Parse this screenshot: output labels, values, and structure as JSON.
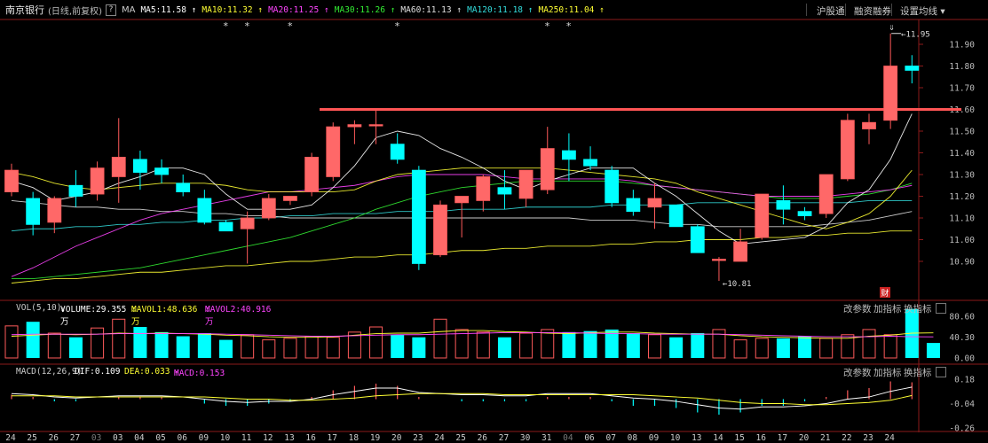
{
  "header": {
    "title": "南京银行",
    "subtitle": "(日线,前复权)",
    "help": "?",
    "ma_label": "MA",
    "ma_items": [
      {
        "text": "MA5:11.58",
        "color": "#ffffff"
      },
      {
        "text": "MA10:11.32",
        "color": "#ffff33"
      },
      {
        "text": "MA20:11.25",
        "color": "#ff44ff"
      },
      {
        "text": "MA30:11.26",
        "color": "#33ee33"
      },
      {
        "text": "MA60:11.13",
        "color": "#e0e0e0"
      },
      {
        "text": "MA120:11.18",
        "color": "#33dddd"
      },
      {
        "text": "MA250:11.04",
        "color": "#ffff33"
      }
    ],
    "arrow_up": "↑",
    "links": {
      "hgt": "沪股通",
      "rzrq": "融资融券",
      "settings": "设置均线"
    }
  },
  "price_axis": [
    "11.90",
    "11.80",
    "11.70",
    "11.60",
    "11.50",
    "11.40",
    "11.30",
    "11.20",
    "11.10",
    "11.00",
    "10.90"
  ],
  "annotations": {
    "high": "11.95",
    "low": "10.81",
    "fin_badge": "财",
    "star": "*"
  },
  "volume_panel": {
    "label": "VOL(5,10)",
    "volume": "VOLUME:29.355万",
    "mavol1": "MAVOL1:48.636万",
    "mavol2": "MAVOL2:40.916万",
    "arrow_down": "↓",
    "buttons": {
      "params": "改参数",
      "add": "加指标",
      "swap": "换指标"
    },
    "axis": [
      "80.60",
      "40.30",
      "0.00"
    ]
  },
  "macd_panel": {
    "label": "MACD(12,26,9)",
    "dif": "DIF:0.109",
    "dea": "DEA:0.033",
    "macd": "MACD:0.153",
    "arrow_up": "↑",
    "buttons": {
      "params": "改参数",
      "add": "加指标",
      "swap": "换指标"
    },
    "axis": [
      "0.18",
      "-0.04",
      "-0.26"
    ]
  },
  "date_axis": [
    "24",
    "25",
    "26",
    "27",
    "03",
    "03",
    "04",
    "05",
    "06",
    "09",
    "10",
    "11",
    "12",
    "13",
    "16",
    "17",
    "18",
    "19",
    "20",
    "23",
    "24",
    "25",
    "26",
    "27",
    "30",
    "31",
    "04",
    "06",
    "07",
    "08",
    "09",
    "10",
    "13",
    "14",
    "15",
    "16",
    "17",
    "20",
    "21",
    "22",
    "23",
    "24"
  ],
  "chart_data": {
    "type": "candlestick",
    "price_range": [
      10.8,
      11.97
    ],
    "resistance_line": 11.6,
    "candles": [
      {
        "o": 11.22,
        "h": 11.35,
        "l": 11.2,
        "c": 11.32
      },
      {
        "o": 11.19,
        "h": 11.22,
        "l": 11.02,
        "c": 11.07
      },
      {
        "o": 11.08,
        "h": 11.2,
        "l": 11.03,
        "c": 11.19
      },
      {
        "o": 11.25,
        "h": 11.32,
        "l": 11.15,
        "c": 11.2
      },
      {
        "o": 11.21,
        "h": 11.36,
        "l": 11.18,
        "c": 11.33
      },
      {
        "o": 11.29,
        "h": 11.56,
        "l": 11.17,
        "c": 11.38
      },
      {
        "o": 11.37,
        "h": 11.41,
        "l": 11.23,
        "c": 11.31
      },
      {
        "o": 11.33,
        "h": 11.37,
        "l": 11.26,
        "c": 11.3
      },
      {
        "o": 11.26,
        "h": 11.3,
        "l": 11.2,
        "c": 11.22
      },
      {
        "o": 11.19,
        "h": 11.23,
        "l": 11.07,
        "c": 11.08
      },
      {
        "o": 11.08,
        "h": 11.09,
        "l": 11.04,
        "c": 11.04
      },
      {
        "o": 11.05,
        "h": 11.13,
        "l": 10.89,
        "c": 11.1
      },
      {
        "o": 11.1,
        "h": 11.21,
        "l": 11.09,
        "c": 11.19
      },
      {
        "o": 11.18,
        "h": 11.2,
        "l": 11.16,
        "c": 11.2
      },
      {
        "o": 11.22,
        "h": 11.4,
        "l": 11.2,
        "c": 11.38
      },
      {
        "o": 11.29,
        "h": 11.54,
        "l": 11.27,
        "c": 11.52
      },
      {
        "o": 11.52,
        "h": 11.55,
        "l": 11.44,
        "c": 11.53
      },
      {
        "o": 11.53,
        "h": 11.6,
        "l": 11.44,
        "c": 11.53
      },
      {
        "o": 11.44,
        "h": 11.49,
        "l": 11.35,
        "c": 11.37
      },
      {
        "o": 11.32,
        "h": 11.34,
        "l": 10.86,
        "c": 10.89
      },
      {
        "o": 10.93,
        "h": 11.18,
        "l": 10.92,
        "c": 11.16
      },
      {
        "o": 11.17,
        "h": 11.2,
        "l": 11.01,
        "c": 11.2
      },
      {
        "o": 11.18,
        "h": 11.3,
        "l": 11.13,
        "c": 11.29
      },
      {
        "o": 11.24,
        "h": 11.32,
        "l": 11.14,
        "c": 11.21
      },
      {
        "o": 11.19,
        "h": 11.32,
        "l": 11.15,
        "c": 11.32
      },
      {
        "o": 11.23,
        "h": 11.52,
        "l": 11.21,
        "c": 11.42
      },
      {
        "o": 11.41,
        "h": 11.49,
        "l": 11.27,
        "c": 11.37
      },
      {
        "o": 11.37,
        "h": 11.43,
        "l": 11.32,
        "c": 11.34
      },
      {
        "o": 11.32,
        "h": 11.34,
        "l": 11.15,
        "c": 11.17
      },
      {
        "o": 11.19,
        "h": 11.23,
        "l": 11.11,
        "c": 11.13
      },
      {
        "o": 11.15,
        "h": 11.26,
        "l": 11.05,
        "c": 11.19
      },
      {
        "o": 11.16,
        "h": 11.16,
        "l": 11.07,
        "c": 11.06
      },
      {
        "o": 11.06,
        "h": 11.07,
        "l": 10.95,
        "c": 10.94
      },
      {
        "o": 10.91,
        "h": 10.92,
        "l": 10.81,
        "c": 10.91
      },
      {
        "o": 10.9,
        "h": 11.05,
        "l": 10.9,
        "c": 10.99
      },
      {
        "o": 11.01,
        "h": 11.2,
        "l": 11.0,
        "c": 11.21
      },
      {
        "o": 11.18,
        "h": 11.25,
        "l": 11.07,
        "c": 11.14
      },
      {
        "o": 11.13,
        "h": 11.15,
        "l": 11.09,
        "c": 11.11
      },
      {
        "o": 11.12,
        "h": 11.3,
        "l": 11.1,
        "c": 11.3
      },
      {
        "o": 11.28,
        "h": 11.58,
        "l": 11.27,
        "c": 11.55
      },
      {
        "o": 11.51,
        "h": 11.58,
        "l": 11.44,
        "c": 11.54
      },
      {
        "o": 11.55,
        "h": 11.95,
        "l": 11.51,
        "c": 11.8
      },
      {
        "o": 11.8,
        "h": 11.85,
        "l": 11.72,
        "c": 11.78
      }
    ],
    "ma_lines": {
      "ma5": {
        "color": "#ffffff",
        "values": [
          11.27,
          11.24,
          11.18,
          11.2,
          11.22,
          11.26,
          11.29,
          11.33,
          11.33,
          11.3,
          11.21,
          11.14,
          11.14,
          11.14,
          11.16,
          11.24,
          11.34,
          11.47,
          11.5,
          11.48,
          11.42,
          11.38,
          11.33,
          11.27,
          11.23,
          11.27,
          11.3,
          11.33,
          11.33,
          11.33,
          11.26,
          11.2,
          11.12,
          11.04,
          10.98,
          10.99,
          11.0,
          11.01,
          11.06,
          11.17,
          11.23,
          11.37,
          11.58
        ]
      },
      "ma10": {
        "color": "#ffff33",
        "values": [
          11.31,
          11.29,
          11.26,
          11.24,
          11.23,
          11.24,
          11.25,
          11.26,
          11.26,
          11.26,
          11.25,
          11.23,
          11.22,
          11.22,
          11.22,
          11.22,
          11.23,
          11.27,
          11.3,
          11.31,
          11.32,
          11.33,
          11.33,
          11.33,
          11.33,
          11.33,
          11.32,
          11.31,
          11.3,
          11.29,
          11.28,
          11.26,
          11.22,
          11.19,
          11.16,
          11.13,
          11.1,
          11.07,
          11.05,
          11.08,
          11.12,
          11.2,
          11.32
        ]
      },
      "ma20": {
        "color": "#ff44ff",
        "values": [
          10.83,
          10.87,
          10.92,
          10.97,
          11.01,
          11.05,
          11.09,
          11.12,
          11.14,
          11.16,
          11.18,
          11.2,
          11.22,
          11.22,
          11.23,
          11.24,
          11.25,
          11.27,
          11.29,
          11.3,
          11.3,
          11.3,
          11.3,
          11.29,
          11.28,
          11.28,
          11.28,
          11.28,
          11.28,
          11.27,
          11.25,
          11.24,
          11.23,
          11.22,
          11.21,
          11.2,
          11.2,
          11.2,
          11.2,
          11.21,
          11.22,
          11.23,
          11.25
        ]
      },
      "ma30": {
        "color": "#33ee33",
        "values": [
          10.82,
          10.82,
          10.83,
          10.84,
          10.85,
          10.86,
          10.87,
          10.89,
          10.91,
          10.93,
          10.95,
          10.97,
          10.99,
          11.01,
          11.04,
          11.07,
          11.1,
          11.14,
          11.17,
          11.2,
          11.22,
          11.24,
          11.25,
          11.26,
          11.27,
          11.27,
          11.27,
          11.27,
          11.27,
          11.26,
          11.25,
          11.24,
          11.23,
          11.22,
          11.21,
          11.2,
          11.19,
          11.19,
          11.19,
          11.2,
          11.21,
          11.23,
          11.26
        ]
      },
      "ma60": {
        "color": "#e0e0e0",
        "values": [
          11.18,
          11.17,
          11.16,
          11.15,
          11.15,
          11.14,
          11.14,
          11.13,
          11.13,
          11.12,
          11.12,
          11.11,
          11.11,
          11.1,
          11.1,
          11.1,
          11.1,
          11.1,
          11.1,
          11.1,
          11.1,
          11.1,
          11.1,
          11.1,
          11.1,
          11.1,
          11.1,
          11.09,
          11.09,
          11.09,
          11.08,
          11.07,
          11.07,
          11.06,
          11.06,
          11.06,
          11.06,
          11.06,
          11.07,
          11.08,
          11.09,
          11.11,
          11.13
        ]
      },
      "ma120": {
        "color": "#33dddd",
        "values": [
          11.04,
          11.05,
          11.05,
          11.06,
          11.06,
          11.07,
          11.07,
          11.08,
          11.08,
          11.09,
          11.09,
          11.1,
          11.1,
          11.11,
          11.11,
          11.12,
          11.12,
          11.12,
          11.13,
          11.13,
          11.13,
          11.14,
          11.14,
          11.14,
          11.15,
          11.15,
          11.15,
          11.15,
          11.16,
          11.16,
          11.16,
          11.16,
          11.17,
          11.17,
          11.17,
          11.17,
          11.17,
          11.17,
          11.17,
          11.17,
          11.18,
          11.18,
          11.18
        ]
      },
      "ma250": {
        "color": "#ffff33",
        "values": [
          10.8,
          10.81,
          10.82,
          10.82,
          10.83,
          10.84,
          10.85,
          10.85,
          10.86,
          10.87,
          10.88,
          10.88,
          10.89,
          10.9,
          10.9,
          10.91,
          10.92,
          10.92,
          10.93,
          10.93,
          10.94,
          10.95,
          10.95,
          10.96,
          10.96,
          10.97,
          10.97,
          10.97,
          10.98,
          10.98,
          10.99,
          10.99,
          11.0,
          11.0,
          11.0,
          11.01,
          11.01,
          11.02,
          11.02,
          11.03,
          11.03,
          11.04,
          11.04
        ]
      }
    },
    "volume": [
      62,
      70,
      48,
      40,
      58,
      75,
      60,
      50,
      42,
      48,
      35,
      45,
      35,
      38,
      42,
      40,
      50,
      60,
      45,
      40,
      75,
      55,
      50,
      40,
      48,
      55,
      50,
      52,
      55,
      48,
      45,
      40,
      48,
      55,
      35,
      38,
      38,
      42,
      38,
      45,
      55,
      45,
      95,
      29
    ],
    "mavol1": [
      42,
      44,
      46,
      45,
      46,
      48,
      47,
      48,
      47,
      46,
      44,
      43,
      41,
      40,
      40,
      41,
      44,
      47,
      48,
      48,
      51,
      53,
      53,
      51,
      50,
      48,
      47,
      49,
      50,
      50,
      48,
      47,
      46,
      46,
      43,
      41,
      40,
      39,
      38,
      38,
      42,
      44,
      48,
      48.6
    ],
    "mavol2": [
      45,
      46,
      46,
      46,
      46,
      47,
      47,
      47,
      47,
      47,
      46,
      45,
      44,
      43,
      42,
      42,
      43,
      44,
      45,
      45,
      46,
      47,
      48,
      49,
      49,
      49,
      49,
      48,
      47,
      47,
      46,
      46,
      46,
      46,
      45,
      44,
      43,
      42,
      41,
      41,
      41,
      42,
      41,
      40.9
    ],
    "dif": [
      0.05,
      0.04,
      0.02,
      0.01,
      0.02,
      0.03,
      0.03,
      0.03,
      0.02,
      0.0,
      -0.02,
      -0.03,
      -0.02,
      -0.02,
      0.0,
      0.04,
      0.07,
      0.1,
      0.1,
      0.06,
      0.05,
      0.04,
      0.04,
      0.03,
      0.03,
      0.05,
      0.05,
      0.05,
      0.03,
      0.01,
      0.0,
      -0.02,
      -0.05,
      -0.08,
      -0.09,
      -0.07,
      -0.07,
      -0.06,
      -0.04,
      0.0,
      0.02,
      0.07,
      0.109
    ],
    "dea": [
      0.03,
      0.03,
      0.03,
      0.02,
      0.02,
      0.02,
      0.02,
      0.02,
      0.02,
      0.02,
      0.01,
      0.0,
      0.0,
      -0.01,
      -0.01,
      0.0,
      0.01,
      0.03,
      0.04,
      0.05,
      0.05,
      0.05,
      0.05,
      0.04,
      0.04,
      0.04,
      0.04,
      0.04,
      0.04,
      0.04,
      0.03,
      0.02,
      0.01,
      -0.01,
      -0.03,
      -0.04,
      -0.04,
      -0.05,
      -0.05,
      -0.04,
      -0.03,
      -0.01,
      0.033
    ]
  }
}
